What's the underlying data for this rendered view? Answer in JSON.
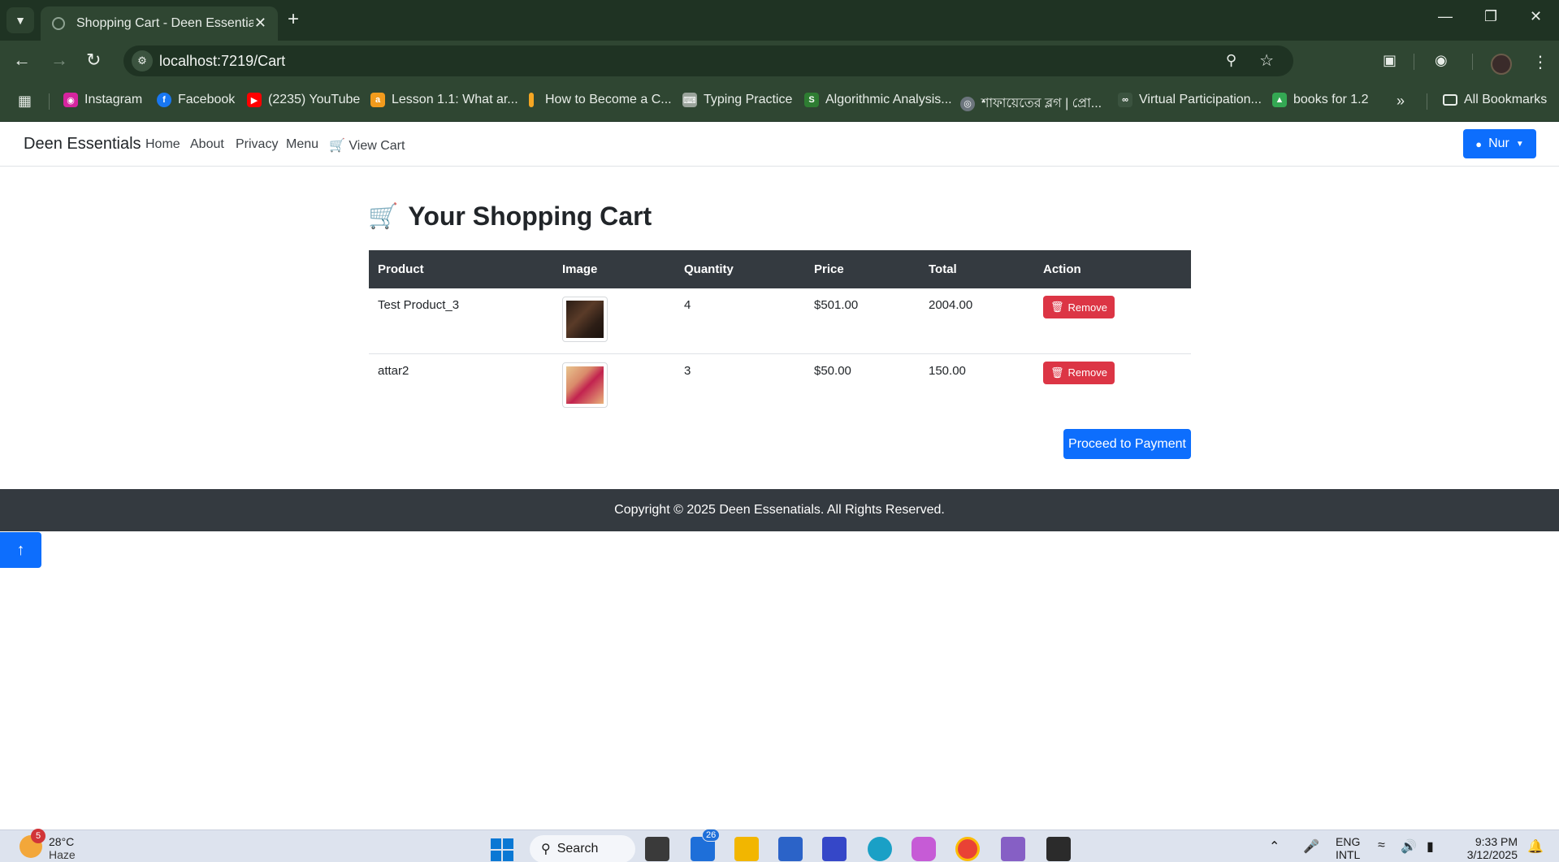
{
  "browser": {
    "tab_title": "Shopping Cart - Deen Essentials",
    "url": "localhost:7219/Cart",
    "bookmarks": [
      {
        "label": "Instagram",
        "icon": "instagram-icon",
        "color": "#d6249f"
      },
      {
        "label": "Facebook",
        "icon": "facebook-icon",
        "color": "#1877f2"
      },
      {
        "label": "(2235) YouTube",
        "icon": "youtube-icon",
        "color": "#ff0000"
      },
      {
        "label": "Lesson 1.1: What ar...",
        "icon": "lesson-icon",
        "color": "#f29b1d"
      },
      {
        "label": "How to Become a C...",
        "icon": "article-icon",
        "color": "#f5a623"
      },
      {
        "label": "Typing Practice",
        "icon": "typing-icon",
        "color": "#9aa39b"
      },
      {
        "label": "Algorithmic Analysis...",
        "icon": "algo-icon",
        "color": "#2e7d32"
      },
      {
        "label": "শাফায়েতের ব্লগ | প্রো...",
        "icon": "globe-icon",
        "color": "#6c757d"
      },
      {
        "label": "Virtual Participation...",
        "icon": "participation-icon",
        "color": "#6c757d"
      },
      {
        "label": "books for 1.2",
        "icon": "google-drive-icon",
        "color": "#34a853"
      }
    ],
    "all_bookmarks": "All Bookmarks"
  },
  "navbar": {
    "brand": "Deen Essentials",
    "links": [
      "Home",
      "About",
      "Privacy",
      "Menu"
    ],
    "view_cart": "View Cart",
    "user": "Nur"
  },
  "cart": {
    "title": "Your Shopping Cart",
    "columns": [
      "Product",
      "Image",
      "Quantity",
      "Price",
      "Total",
      "Action"
    ],
    "rows": [
      {
        "product": "Test Product_3",
        "quantity": "4",
        "price": "$501.00",
        "total": "2004.00",
        "action": "Remove"
      },
      {
        "product": "attar2",
        "quantity": "3",
        "price": "$50.00",
        "total": "150.00",
        "action": "Remove"
      }
    ],
    "proceed": "Proceed to Payment"
  },
  "footer": {
    "text": "Copyright © 2025 Deen Essenatials. All Rights Reserved."
  },
  "taskbar": {
    "weather_badge": "5",
    "temperature": "28°C",
    "condition": "Haze",
    "search": "Search",
    "store_badge": "26",
    "lang": "ENG",
    "lang_sub": "INTL",
    "time": "9:33 PM",
    "date": "3/12/2025"
  },
  "colors": {
    "primary": "#0d6efd",
    "danger": "#dc3545",
    "dark": "#343a40",
    "chrome": "#2f4632"
  }
}
